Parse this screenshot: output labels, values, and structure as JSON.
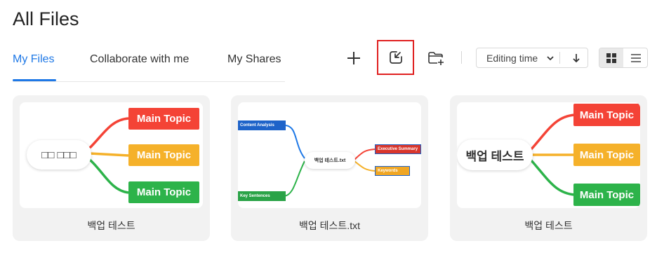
{
  "page": {
    "title": "All Files"
  },
  "tabs": [
    {
      "label": "My Files",
      "active": true
    },
    {
      "label": "Collaborate with me",
      "active": false
    },
    {
      "label": "My Shares",
      "active": false
    }
  ],
  "toolbar": {
    "icons": [
      "plus-icon",
      "import-icon",
      "new-folder-icon"
    ],
    "sort_label": "Editing time",
    "sort_direction": "descending",
    "view_mode": "grid"
  },
  "files": [
    {
      "name": "백업 테스트",
      "thumbnail": {
        "center": "□□ □□□",
        "topics": [
          {
            "label": "Main Topic",
            "color": "#f44336"
          },
          {
            "label": "Main Topic",
            "color": "#f5b12a"
          },
          {
            "label": "Main Topic",
            "color": "#2db34a"
          }
        ]
      }
    },
    {
      "name": "백업 테스트.txt",
      "thumbnail": {
        "center": "백업 테스트.txt",
        "nodes": [
          "Content Analysis",
          "Key Sentences",
          "Executive Summary",
          "Keywords"
        ]
      }
    },
    {
      "name": "백업 테스트",
      "thumbnail": {
        "center": "백업 테스트",
        "topics": [
          {
            "label": "Main Topic",
            "color": "#f44336"
          },
          {
            "label": "Main Topic",
            "color": "#f5b12a"
          },
          {
            "label": "Main Topic",
            "color": "#2db34a"
          }
        ]
      }
    }
  ],
  "colors": {
    "accent": "#1e78e6",
    "highlight": "#e02020"
  }
}
